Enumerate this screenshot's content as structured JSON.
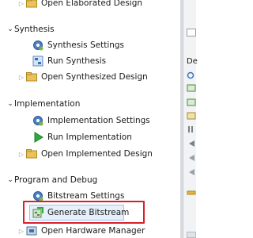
{
  "nav": {
    "top_item": "Open Elaborated Design",
    "synthesis": {
      "header": "Synthesis",
      "items": [
        "Synthesis Settings",
        "Run Synthesis",
        "Open Synthesized Design"
      ]
    },
    "implementation": {
      "header": "Implementation",
      "items": [
        "Implementation Settings",
        "Run Implementation",
        "Open Implemented Design"
      ]
    },
    "program": {
      "header": "Program and Debug",
      "items": [
        "Bitstream Settings",
        "Generate Bitstream",
        "Open Hardware Manager"
      ]
    }
  },
  "right_panel": {
    "tab_label": "De"
  },
  "colors": {
    "highlight": "#d9202a",
    "selection": "#e6f0fb",
    "run_green": "#2eaa3a"
  }
}
